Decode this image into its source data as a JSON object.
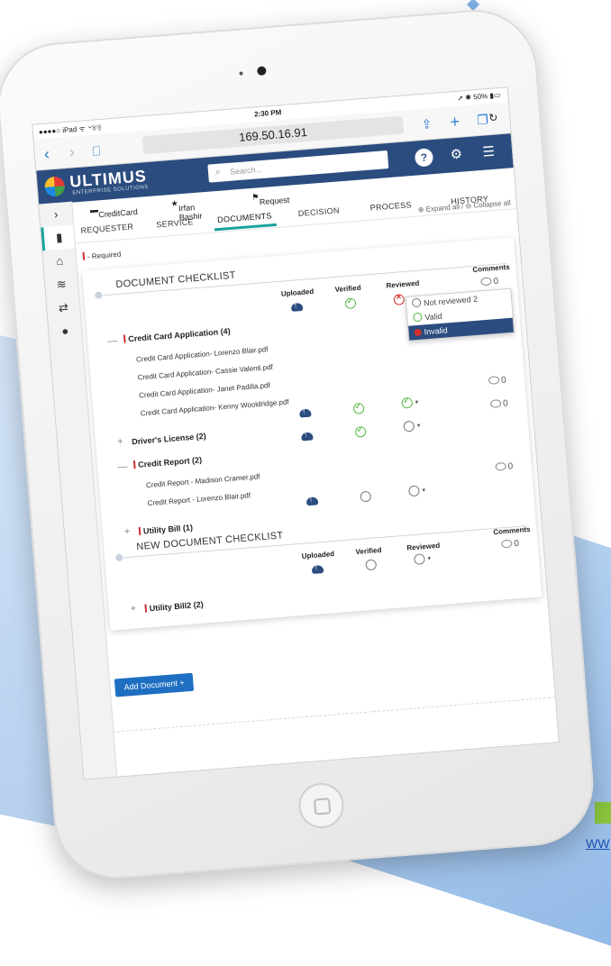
{
  "status": {
    "carrier": "●●●●○ iPad ᯤ ৺৪ড়",
    "time": "2:30 PM",
    "right": "➚ ✱ 50% ▮▭"
  },
  "browser": {
    "url": "169.50.16.91"
  },
  "header": {
    "brand": "ULTIMUS",
    "brand_sub": "ENTERPRISE SOLUTIONS",
    "search_placeholder": "Search..."
  },
  "breadcrumbs": {
    "card": "CreditCard",
    "user": "Irfan Bashir",
    "request": "Request"
  },
  "tabs": [
    "REQUESTER",
    "SERVICE",
    "DOCUMENTS",
    "DECISION",
    "PROCESS",
    "HISTORY"
  ],
  "active_tab": "DOCUMENTS",
  "expand": {
    "expand_label": "Expand all /",
    "collapse_label": "Collapse all"
  },
  "required_label": "- Required",
  "checklist": {
    "title": "DOCUMENT CHECKLIST",
    "col_uploaded": "Uploaded",
    "col_verified": "Verified",
    "col_reviewed": "Reviewed",
    "col_comments": "Comments",
    "comment_count": "0",
    "groups": [
      {
        "label": "Credit Card Application (4)",
        "files": [
          "Credit Card Application- Lorenzo Blair.pdf",
          "Credit Card Application- Cassie Valenti.pdf",
          "Credit Card Application- Janet Padilla.pdf",
          "Credit Card Application- Kenny Wooldridge.pdf"
        ],
        "comments": "0"
      },
      {
        "label": "Driver's License (2)",
        "files": [],
        "comments": "0"
      },
      {
        "label": "Credit Report (2)",
        "files": [
          "Credit Report - Madison Cramer.pdf",
          "Credit Report - Lorenzo Blair.pdf"
        ],
        "comments": "0"
      },
      {
        "label": "Utility Bill (1)",
        "files": []
      }
    ],
    "review_dropdown": [
      "Not reviewed 2",
      "Valid",
      "Invalid"
    ],
    "review_selected": "Invalid"
  },
  "new_checklist": {
    "title": "NEW DOCUMENT CHECKLIST",
    "col_uploaded": "Uploaded",
    "col_verified": "Verified",
    "col_reviewed": "Reviewed",
    "col_comments": "Comments",
    "comment_count": "0",
    "groups": [
      {
        "label": "Utility Bill2 (2)"
      }
    ]
  },
  "add_document_label": "Add Document +",
  "footer_link": "WW",
  "colors": {
    "header": "#2b4c7e",
    "accent": "#1aa39a",
    "valid": "#57b846",
    "invalid": "#d32f2f",
    "button": "#1e6fc2"
  }
}
